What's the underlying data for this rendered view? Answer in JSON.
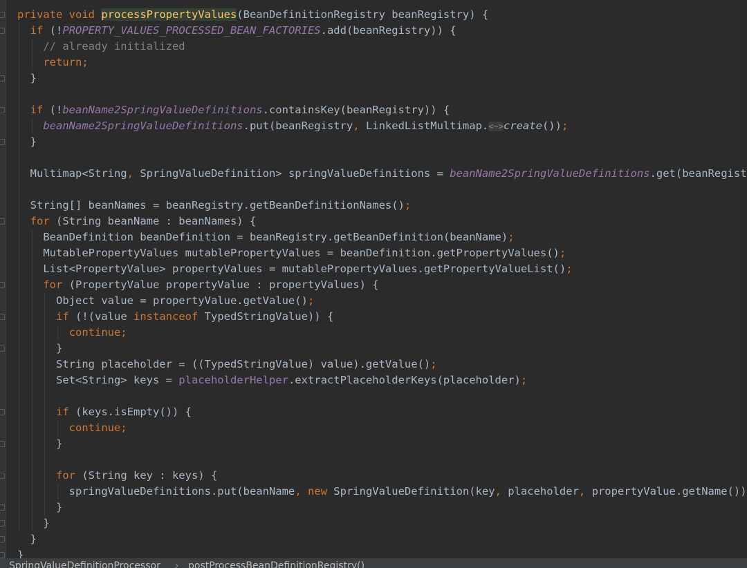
{
  "editor": {
    "theme_colors": {
      "background": "#2b2b2b",
      "keyword": "#cc7832",
      "field": "#9876aa",
      "method_declaration": "#ffc66d",
      "comment": "#808080",
      "text": "#a9b7c6"
    },
    "lines": [
      [
        {
          "t": "private void ",
          "c": "kw"
        },
        {
          "t": "processPropertyValues",
          "c": "mdecl"
        },
        {
          "t": "(BeanDefinitionRegistry beanRegistry) {",
          "c": ""
        }
      ],
      [
        {
          "t": "  ",
          "c": ""
        },
        {
          "t": "if ",
          "c": "kw"
        },
        {
          "t": "(!",
          "c": ""
        },
        {
          "t": "PROPERTY_VALUES_PROCESSED_BEAN_FACTORIES",
          "c": "field"
        },
        {
          "t": ".add(beanRegistry)) {",
          "c": ""
        }
      ],
      [
        {
          "t": "    ",
          "c": ""
        },
        {
          "t": "// already initialized",
          "c": "cmt"
        }
      ],
      [
        {
          "t": "    ",
          "c": ""
        },
        {
          "t": "return;",
          "c": "kw"
        }
      ],
      [
        {
          "t": "  }",
          "c": ""
        }
      ],
      [],
      [
        {
          "t": "  ",
          "c": ""
        },
        {
          "t": "if ",
          "c": "kw"
        },
        {
          "t": "(!",
          "c": ""
        },
        {
          "t": "beanName2SpringValueDefinitions",
          "c": "field"
        },
        {
          "t": ".containsKey(beanRegistry)) {",
          "c": ""
        }
      ],
      [
        {
          "t": "    ",
          "c": ""
        },
        {
          "t": "beanName2SpringValueDefinitions",
          "c": "field"
        },
        {
          "t": ".put(beanRegistry",
          "c": ""
        },
        {
          "t": ", ",
          "c": "punc"
        },
        {
          "t": "LinkedListMultimap.",
          "c": ""
        },
        {
          "t": "<~>",
          "c": "gen"
        },
        {
          "t": "create",
          "c": "smeth"
        },
        {
          "t": "())",
          "c": ""
        },
        {
          "t": ";",
          "c": "punc"
        }
      ],
      [
        {
          "t": "  }",
          "c": ""
        }
      ],
      [],
      [
        {
          "t": "  Multimap<String",
          "c": ""
        },
        {
          "t": ", ",
          "c": "punc"
        },
        {
          "t": "SpringValueDefinition> springValueDefinitions = ",
          "c": ""
        },
        {
          "t": "beanName2SpringValueDefinitions",
          "c": "field"
        },
        {
          "t": ".get(beanRegistry)",
          "c": ""
        },
        {
          "t": ";",
          "c": "punc"
        }
      ],
      [],
      [
        {
          "t": "  String[] beanNames = beanRegistry.getBeanDefinitionNames()",
          "c": ""
        },
        {
          "t": ";",
          "c": "punc"
        }
      ],
      [
        {
          "t": "  ",
          "c": ""
        },
        {
          "t": "for ",
          "c": "kw"
        },
        {
          "t": "(String beanName : beanNames) {",
          "c": ""
        }
      ],
      [
        {
          "t": "    BeanDefinition beanDefinition = beanRegistry.getBeanDefinition(beanName)",
          "c": ""
        },
        {
          "t": ";",
          "c": "punc"
        }
      ],
      [
        {
          "t": "    MutablePropertyValues mutablePropertyValues = beanDefinition.getPropertyValues()",
          "c": ""
        },
        {
          "t": ";",
          "c": "punc"
        }
      ],
      [
        {
          "t": "    List<PropertyValue> propertyValues = mutablePropertyValues.getPropertyValueList()",
          "c": ""
        },
        {
          "t": ";",
          "c": "punc"
        }
      ],
      [
        {
          "t": "    ",
          "c": ""
        },
        {
          "t": "for ",
          "c": "kw"
        },
        {
          "t": "(PropertyValue propertyValue : propertyValues) {",
          "c": ""
        }
      ],
      [
        {
          "t": "      Object value = propertyValue.getValue()",
          "c": ""
        },
        {
          "t": ";",
          "c": "punc"
        }
      ],
      [
        {
          "t": "      ",
          "c": ""
        },
        {
          "t": "if ",
          "c": "kw"
        },
        {
          "t": "(!(value ",
          "c": ""
        },
        {
          "t": "instanceof ",
          "c": "kw"
        },
        {
          "t": "TypedStringValue)) {",
          "c": ""
        }
      ],
      [
        {
          "t": "        ",
          "c": ""
        },
        {
          "t": "continue;",
          "c": "kw"
        }
      ],
      [
        {
          "t": "      }",
          "c": ""
        }
      ],
      [
        {
          "t": "      String placeholder = ((TypedStringValue) value).getValue()",
          "c": ""
        },
        {
          "t": ";",
          "c": "punc"
        }
      ],
      [
        {
          "t": "      Set<String> keys = ",
          "c": ""
        },
        {
          "t": "placeholderHelper",
          "c": "ifield"
        },
        {
          "t": ".extractPlaceholderKeys(placeholder)",
          "c": ""
        },
        {
          "t": ";",
          "c": "punc"
        }
      ],
      [],
      [
        {
          "t": "      ",
          "c": ""
        },
        {
          "t": "if ",
          "c": "kw"
        },
        {
          "t": "(keys.isEmpty()) {",
          "c": ""
        }
      ],
      [
        {
          "t": "        ",
          "c": ""
        },
        {
          "t": "continue;",
          "c": "kw"
        }
      ],
      [
        {
          "t": "      }",
          "c": ""
        }
      ],
      [],
      [
        {
          "t": "      ",
          "c": ""
        },
        {
          "t": "for ",
          "c": "kw"
        },
        {
          "t": "(String key : keys) {",
          "c": ""
        }
      ],
      [
        {
          "t": "        springValueDefinitions.put(beanName",
          "c": ""
        },
        {
          "t": ", ",
          "c": "punc"
        },
        {
          "t": "new ",
          "c": "kw"
        },
        {
          "t": "SpringValueDefinition(key",
          "c": ""
        },
        {
          "t": ", ",
          "c": "punc"
        },
        {
          "t": "placeholder",
          "c": ""
        },
        {
          "t": ", ",
          "c": "punc"
        },
        {
          "t": "propertyValue.getName()))",
          "c": ""
        },
        {
          "t": ";",
          "c": "punc"
        }
      ],
      [
        {
          "t": "      }",
          "c": ""
        }
      ],
      [
        {
          "t": "    }",
          "c": ""
        }
      ],
      [
        {
          "t": "  }",
          "c": ""
        }
      ],
      [
        {
          "t": "}",
          "c": ""
        }
      ]
    ]
  },
  "breadcrumb": {
    "class_name": "SpringValueDefinitionProcessor",
    "separator": "›",
    "method_name": "postProcessBeanDefinitionRegistry()"
  }
}
